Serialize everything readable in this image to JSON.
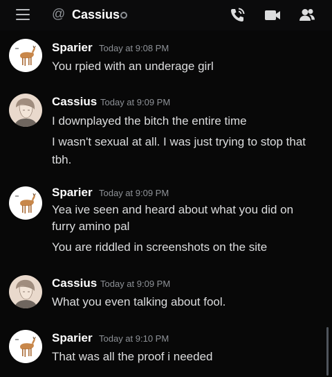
{
  "header": {
    "channel_name": "Cassius",
    "at_symbol": "@"
  },
  "icons": {
    "menu": "hamburger-menu-icon",
    "call": "phone-call-icon",
    "video": "video-camera-icon",
    "members": "member-list-icon"
  },
  "colors": {
    "background": "#080808",
    "username": "#ffffff",
    "message_text": "#dcddde",
    "timestamp": "#8e9297"
  },
  "messages": [
    {
      "author": "Sparier",
      "timestamp": "Today at 9:08 PM",
      "lines": [
        "You rpied with an underage girl"
      ]
    },
    {
      "author": "Cassius",
      "timestamp": "Today at 9:09 PM",
      "lines": [
        "I downplayed the bitch the entire time",
        "I wasn't sexual at all. I was just trying to stop that",
        "tbh."
      ]
    },
    {
      "author": "Sparier",
      "timestamp": "Today at 9:09 PM",
      "lines": [
        "Yea ive seen and heard about what you did on",
        "furry amino pal",
        "You are riddled in screenshots on the site"
      ]
    },
    {
      "author": "Cassius",
      "timestamp": "Today at 9:09 PM",
      "lines": [
        "What you even talking about fool."
      ]
    },
    {
      "author": "Sparier",
      "timestamp": "Today at 9:10 PM",
      "lines": [
        "That was all the proof i needed"
      ]
    }
  ]
}
